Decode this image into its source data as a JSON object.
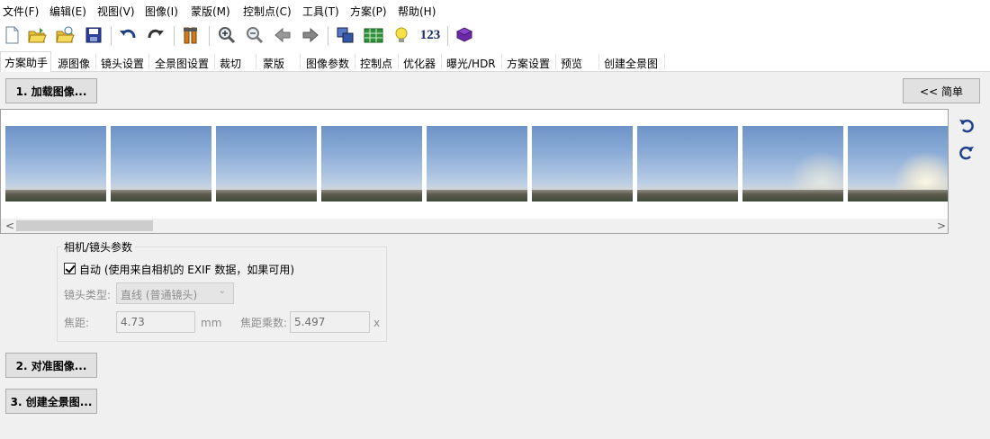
{
  "menu": [
    "文件(F)",
    "编辑(E)",
    "视图(V)",
    "图像(I)",
    "蒙版(M)",
    "控制点(C)",
    "工具(T)",
    "方案(P)",
    "帮助(H)"
  ],
  "toolbar": {
    "icons": [
      "new-document-icon",
      "open-folder-icon",
      "open-recent-icon",
      "save-disk-icon",
      "undo-icon",
      "redo-icon",
      "tools-icon",
      "zoom-in-icon",
      "zoom-out-icon",
      "back-arrow-icon",
      "forward-arrow-icon",
      "panorama-preview-icon",
      "table-grid-icon",
      "lightbulb-icon",
      "numbers-icon",
      "book-icon"
    ],
    "numbers_label": "123"
  },
  "tabs": [
    "方案助手",
    "源图像",
    "镜头设置",
    "全景图设置",
    "裁切",
    "蒙版",
    "图像参数",
    "控制点",
    "优化器",
    "曝光/HDR",
    "方案设置",
    "预览",
    "创建全景图"
  ],
  "active_tab": "方案助手",
  "buttons": {
    "load_images": "1. 加载图像...",
    "simple": "<< 简单",
    "align_images": "2. 对准图像...",
    "create_panorama": "3. 创建全景图..."
  },
  "image_strip": {
    "thumbnail_count": 9,
    "scroll_left": "<",
    "scroll_right": ">"
  },
  "camera_lens": {
    "group_title": "相机/镜头参数",
    "auto_label": "自动 (使用来自相机的 EXIF 数据，如果可用)",
    "auto_checked": true,
    "lens_type_label": "镜头类型:",
    "lens_type_value": "直线 (普通镜头)",
    "focal_length_label": "焦距:",
    "focal_length_value": "4.73",
    "focal_length_unit": "mm",
    "crop_factor_label": "焦距乘数:",
    "crop_factor_value": "5.497",
    "crop_factor_unit": "x"
  }
}
